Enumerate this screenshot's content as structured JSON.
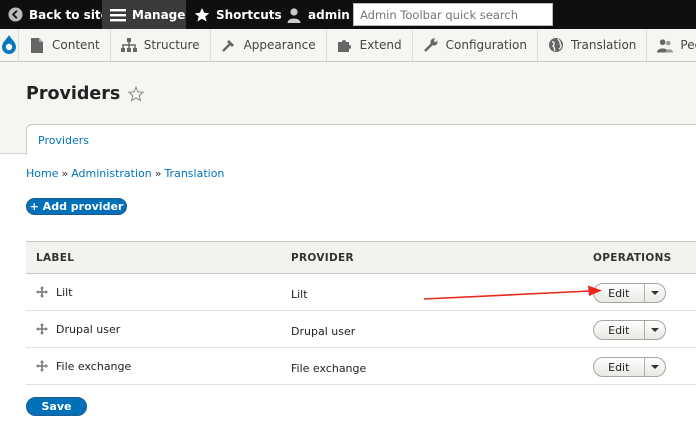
{
  "toolbar": {
    "back_label": "Back to site",
    "manage_label": "Manage",
    "shortcuts_label": "Shortcuts",
    "user_label": "admin",
    "search_placeholder": "Admin Toolbar quick search"
  },
  "tray": {
    "items": [
      {
        "label": "Content",
        "icon": "file-icon"
      },
      {
        "label": "Structure",
        "icon": "sitemap-icon"
      },
      {
        "label": "Appearance",
        "icon": "wrench-brush-icon"
      },
      {
        "label": "Extend",
        "icon": "puzzle-icon"
      },
      {
        "label": "Configuration",
        "icon": "wrench-icon"
      },
      {
        "label": "Translation",
        "icon": "globe-icon"
      },
      {
        "label": "People",
        "icon": "people-icon"
      }
    ]
  },
  "page": {
    "title": "Providers",
    "tab_label": "Providers"
  },
  "breadcrumb": {
    "home": "Home",
    "administration": "Administration",
    "translation": "Translation",
    "separator": "»"
  },
  "actions": {
    "add_provider": "+ Add provider",
    "save": "Save"
  },
  "table": {
    "headers": {
      "label": "LABEL",
      "provider": "PROVIDER",
      "operations": "OPERATIONS"
    },
    "rows": [
      {
        "label": "Lilt",
        "provider": "Lilt",
        "op": "Edit"
      },
      {
        "label": "Drupal user",
        "provider": "Drupal user",
        "op": "Edit"
      },
      {
        "label": "File exchange",
        "provider": "File exchange",
        "op": "Edit"
      }
    ]
  },
  "colors": {
    "accent": "#0071b8",
    "link": "#0074bd",
    "annotation_arrow": "#e8291c",
    "toolbar_bg": "#0f0f0f"
  }
}
